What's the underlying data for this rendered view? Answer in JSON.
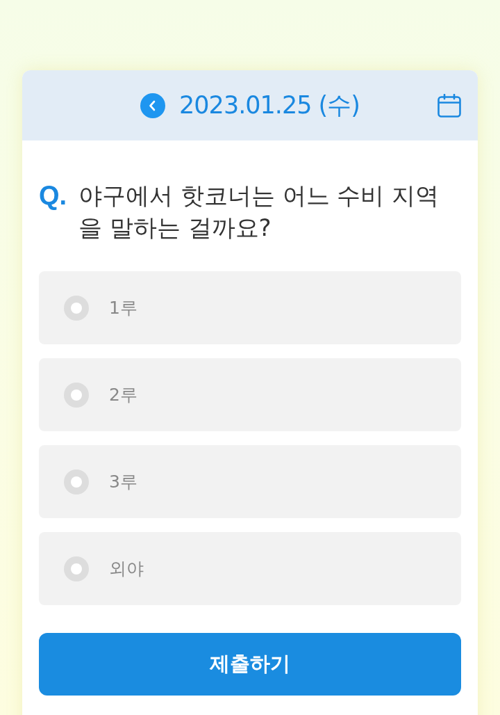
{
  "header": {
    "date": "2023.01.25 (수)"
  },
  "question": {
    "marker": "Q.",
    "text": "야구에서 핫코너는 어느 수비 지역을 말하는 걸까요?"
  },
  "options": [
    {
      "label": "1루",
      "selected": false
    },
    {
      "label": "2루",
      "selected": false
    },
    {
      "label": "3루",
      "selected": false
    },
    {
      "label": "외야",
      "selected": false
    }
  ],
  "submit_button": "제출하기"
}
